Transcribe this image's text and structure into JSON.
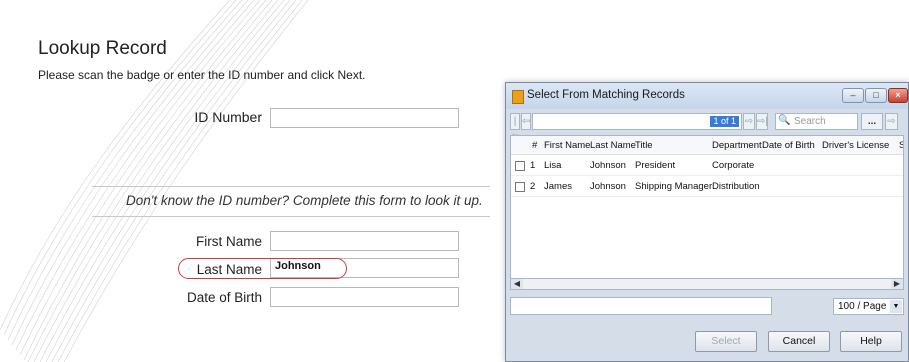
{
  "page": {
    "heading": "Lookup Record",
    "intro": "Please scan the badge or enter the ID number and click Next.",
    "id_number_label": "ID Number",
    "id_number_value": "",
    "helper": "Don't know the ID number? Complete this form to look it up.",
    "first_name_label": "First Name",
    "first_name_value": "",
    "last_name_label": "Last Name",
    "last_name_value": "Johnson",
    "dob_label": "Date of Birth",
    "dob_value": ""
  },
  "dialog": {
    "title": "Select From Matching Records",
    "page_indicator": "1 of 1",
    "search_placeholder": "Search",
    "more_button": "...",
    "columns": [
      "#",
      "First Name",
      "Last Name",
      "Title",
      "Department",
      "Date of Birth",
      "Driver's License",
      "S"
    ],
    "rows": [
      {
        "num": "1",
        "first": "Lisa",
        "last": "Johnson",
        "title": "President",
        "department": "Corporate"
      },
      {
        "num": "2",
        "first": "James",
        "last": "Johnson",
        "title": "Shipping Manager",
        "department": "Distribution"
      }
    ],
    "per_page": "100 / Page",
    "buttons": {
      "select": "Select",
      "cancel": "Cancel",
      "help": "Help"
    }
  },
  "colors": {
    "highlight_oval": "#d23a3a",
    "page_badge": "#3a7bd5"
  }
}
